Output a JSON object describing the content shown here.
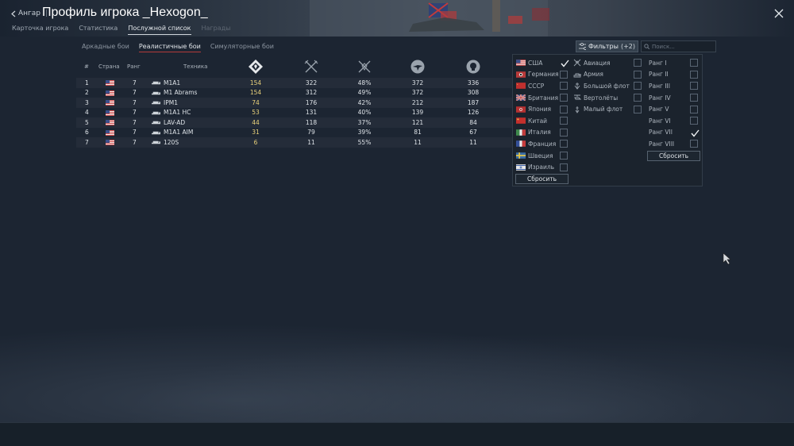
{
  "header": {
    "back_label": "Ангар",
    "title": "Профиль игрока _Hexogon_"
  },
  "tabs": [
    {
      "label": "Карточка игрока"
    },
    {
      "label": "Статистика"
    },
    {
      "label": "Послужной список",
      "active": true
    },
    {
      "label": "Награды",
      "disabled": true
    }
  ],
  "modes": [
    {
      "label": "Аркадные бои"
    },
    {
      "label": "Реалистичные бои",
      "active": true
    },
    {
      "label": "Симуляторные бои"
    }
  ],
  "filter": {
    "label": "Фильтры",
    "count": "(+2)"
  },
  "search": {
    "placeholder": "Поиск..."
  },
  "table": {
    "headers": {
      "num": "#",
      "country": "Страна",
      "rank": "Ранг",
      "vehicle": "Техника"
    },
    "stat_icons": [
      "battles-icon",
      "kills-icon",
      "winrate-icon",
      "respawns-icon",
      "deaths-icon"
    ],
    "rows": [
      {
        "num": "1",
        "country": "usa",
        "rank": "7",
        "vehicle": "M1A1",
        "v1": "154",
        "v2": "322",
        "v3": "48%",
        "v4": "372",
        "v5": "336"
      },
      {
        "num": "2",
        "country": "usa",
        "rank": "7",
        "vehicle": "M1 Abrams",
        "v1": "154",
        "v2": "312",
        "v3": "49%",
        "v4": "372",
        "v5": "308"
      },
      {
        "num": "3",
        "country": "usa",
        "rank": "7",
        "vehicle": "IPM1",
        "v1": "74",
        "v2": "176",
        "v3": "42%",
        "v4": "212",
        "v5": "187"
      },
      {
        "num": "4",
        "country": "usa",
        "rank": "7",
        "vehicle": "M1A1 HC",
        "v1": "53",
        "v2": "131",
        "v3": "40%",
        "v4": "139",
        "v5": "126"
      },
      {
        "num": "5",
        "country": "usa",
        "rank": "7",
        "vehicle": "LAV-AD",
        "v1": "44",
        "v2": "118",
        "v3": "37%",
        "v4": "121",
        "v5": "84"
      },
      {
        "num": "6",
        "country": "usa",
        "rank": "7",
        "vehicle": "M1A1 AIM",
        "v1": "31",
        "v2": "79",
        "v3": "39%",
        "v4": "81",
        "v5": "67"
      },
      {
        "num": "7",
        "country": "usa",
        "rank": "7",
        "vehicle": "120S",
        "v1": "6",
        "v2": "11",
        "v3": "55%",
        "v4": "11",
        "v5": "11"
      }
    ]
  },
  "filters": {
    "countries": [
      {
        "label": "США",
        "flag": "usa",
        "checked": true
      },
      {
        "label": "Германия",
        "flag": "germany",
        "checked": false
      },
      {
        "label": "СССР",
        "flag": "ussr",
        "checked": false
      },
      {
        "label": "Британия",
        "flag": "britain",
        "checked": false
      },
      {
        "label": "Япония",
        "flag": "japan",
        "checked": false
      },
      {
        "label": "Китай",
        "flag": "china",
        "checked": false
      },
      {
        "label": "Италия",
        "flag": "italy",
        "checked": false
      },
      {
        "label": "Франция",
        "flag": "france",
        "checked": false
      },
      {
        "label": "Швеция",
        "flag": "sweden",
        "checked": false
      },
      {
        "label": "Израиль",
        "flag": "israel",
        "checked": false
      }
    ],
    "types": [
      {
        "label": "Авиация",
        "icon": "aviation-icon",
        "checked": false
      },
      {
        "label": "Армия",
        "icon": "army-icon",
        "checked": false
      },
      {
        "label": "Большой флот",
        "icon": "bluewater-fleet-icon",
        "checked": false
      },
      {
        "label": "Вертолёты",
        "icon": "helicopter-icon",
        "checked": false
      },
      {
        "label": "Малый флот",
        "icon": "coastal-fleet-icon",
        "checked": false
      }
    ],
    "ranks": [
      {
        "label": "Ранг I",
        "checked": false
      },
      {
        "label": "Ранг II",
        "checked": false
      },
      {
        "label": "Ранг III",
        "checked": false
      },
      {
        "label": "Ранг IV",
        "checked": false
      },
      {
        "label": "Ранг V",
        "checked": false
      },
      {
        "label": "Ранг VI",
        "checked": false
      },
      {
        "label": "Ранг VII",
        "checked": true
      },
      {
        "label": "Ранг VIII",
        "checked": false
      }
    ],
    "reset_label": "Сбросить"
  },
  "colors": {
    "accent_underline": "#b43a3a",
    "battles_value": "#e9d17a"
  }
}
